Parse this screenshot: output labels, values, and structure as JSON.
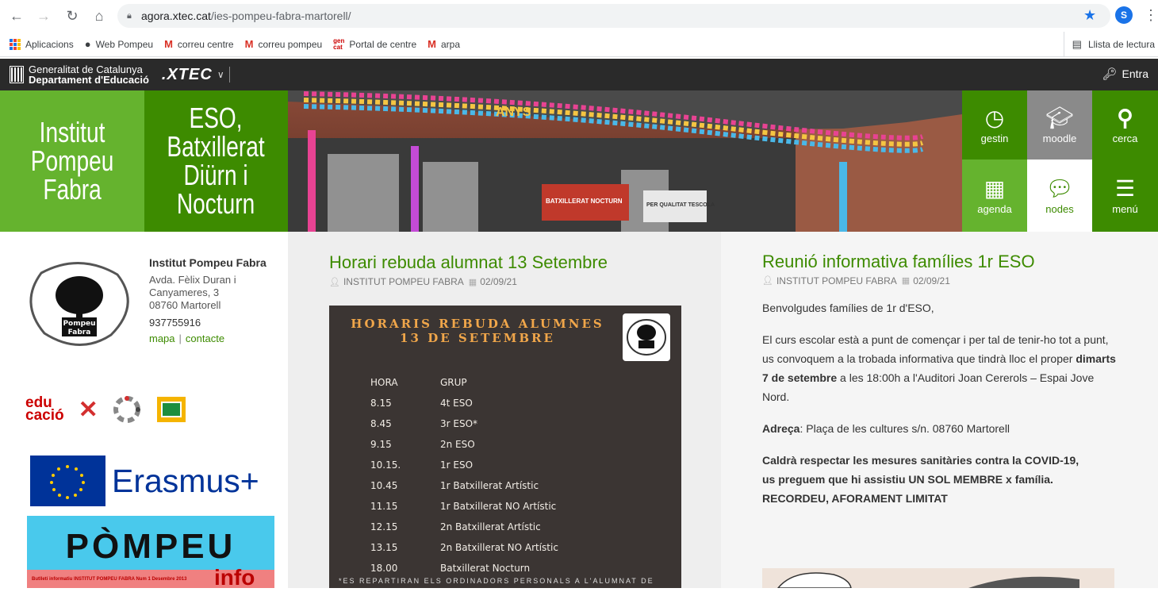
{
  "browser": {
    "url_host": "agora.xtec.cat",
    "url_path": "/ies-pompeu-fabra-martorell/",
    "profile_initial": "S",
    "bookmarks": [
      {
        "label": "Aplicacions",
        "icon": "apps-grid-icon"
      },
      {
        "label": "Web Pompeu",
        "icon": "globe-icon"
      },
      {
        "label": "correu centre",
        "icon": "gmail-icon"
      },
      {
        "label": "correu pompeu",
        "icon": "gmail-icon"
      },
      {
        "label": "Portal de centre",
        "icon": "gencat-icon"
      },
      {
        "label": "arpa",
        "icon": "gmail-icon"
      }
    ],
    "reading_list": "Llista de lectura"
  },
  "xtec_bar": {
    "gencat_line1": "Generalitat de Catalunya",
    "gencat_line2": "Departament d'Educació",
    "xtec_label": ".XTEC",
    "login_label": "Entra"
  },
  "header": {
    "tile1": "Institut\nPompeu\nFabra",
    "tile2": "ESO,\nBatxillerat\nDiürn i\nNocturn",
    "nav": [
      {
        "label": "gestin",
        "icon": "clock-icon"
      },
      {
        "label": "moodle",
        "icon": "graduation-cap-icon"
      },
      {
        "label": "cerca",
        "icon": "search-icon"
      },
      {
        "label": "agenda",
        "icon": "calendar-icon"
      },
      {
        "label": "nodes",
        "icon": "chat-bubbles-icon"
      },
      {
        "label": "menú",
        "icon": "hamburger-menu-icon"
      }
    ],
    "banner_sign_left": "BATXILLERAT NOCTURN",
    "banner_sign_right": "PER QUALITAT TESCOLA",
    "banner_text": "ANYS"
  },
  "sidebar": {
    "school_name": "Institut Pompeu Fabra",
    "address_line1": "Avda. Fèlix Duran i",
    "address_line2": "Canyameres, 3",
    "address_line3": "08760 Martorell",
    "phone": "937755916",
    "link_map": "mapa",
    "link_contact": "contacte",
    "link_separator": "|",
    "educacio_line1": "edu",
    "educacio_line2": "cació",
    "erasmus": "Erasmus+",
    "pompeu_info_text": "PÒMPEU",
    "pompeu_info_suffix": "info",
    "pompeu_info_caption": "Butlletí informatiu INSTITUT POMPEU FABRA Num 1 Desembre 2013"
  },
  "post_left": {
    "title": "Horari rebuda alumnat 13 Setembre",
    "author": "INSTITUT POMPEU FABRA",
    "date": "02/09/21",
    "poster": {
      "title_line1": "HORARIS REBUDA ALUMNES",
      "title_line2": "13 DE SETEMBRE",
      "col_hora": "HORA",
      "col_grup": "GRUP",
      "rows": [
        {
          "hora": "8.15",
          "grup": "4t ESO"
        },
        {
          "hora": "8.45",
          "grup": "3r ESO*"
        },
        {
          "hora": "9.15",
          "grup": "2n ESO"
        },
        {
          "hora": "10.15.",
          "grup": "1r ESO"
        },
        {
          "hora": "10.45",
          "grup": "1r Batxillerat Artístic"
        },
        {
          "hora": "11.15",
          "grup": "1r Batxillerat NO Artístic"
        },
        {
          "hora": "12.15",
          "grup": "2n Batxillerat Artístic"
        },
        {
          "hora": "13.15",
          "grup": "2n Batxillerat NO Artístic"
        },
        {
          "hora": "18.00",
          "grup": "Batxillerat Nocturn"
        }
      ],
      "footer": "*ES REPARTIRAN ELS ORDINADORS PERSONALS A L'ALUMNAT DE"
    }
  },
  "post_right": {
    "title": "Reunió informativa famílies 1r ESO",
    "author": "INSTITUT POMPEU FABRA",
    "date": "02/09/21",
    "greeting": "Benvolgudes famílies de 1r d'ESO,",
    "body_a": "El curs escolar està a punt de començar i per tal de tenir-ho tot a punt, us convoquem a la trobada informativa que tindrà lloc el proper ",
    "body_bold": "dimarts 7 de setembre",
    "body_b": " a les 18:00h a l'Auditori Joan Cererols – Espai Jove Nord.",
    "address_label": "Adreça",
    "address_value": ": Plaça de les cultures s/n. 08760 Martorell",
    "covid_line1": "Caldrà respectar les mesures sanitàries contra la COVID-19,",
    "covid_line2": "us preguem que hi assistiu UN SOL MEMBRE x família.",
    "covid_line3": "RECORDEU, AFORAMENT LIMITAT"
  }
}
